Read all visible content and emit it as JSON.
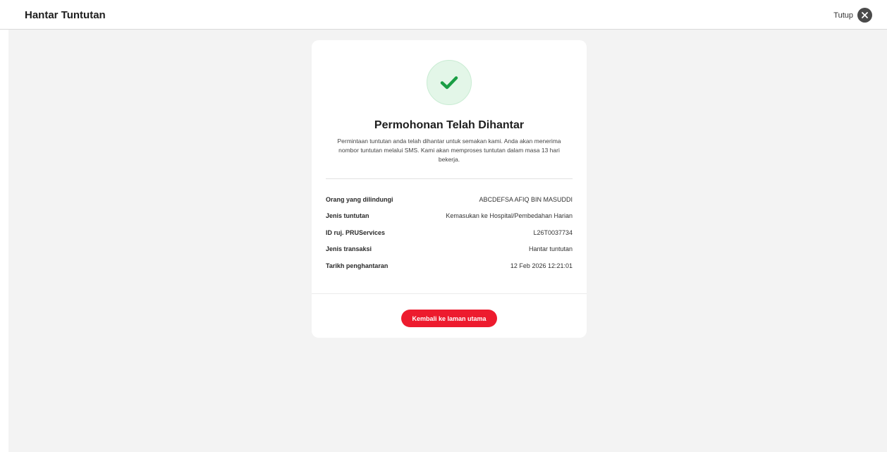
{
  "header": {
    "title": "Hantar Tuntutan",
    "close_label": "Tutup",
    "close_icon": "close-icon"
  },
  "card": {
    "status_icon": "check-icon",
    "colors": {
      "accent": "#ed1b2e",
      "success": "#1a9e45",
      "success_bg": "#e3f6e8"
    },
    "title": "Permohonan Telah Dihantar",
    "description": "Permintaan tuntutan anda telah dihantar untuk semakan kami. Anda akan menerima nombor tuntutan melalui SMS. Kami akan memproses tuntutan dalam masa 13 hari bekerja.",
    "details": [
      {
        "label": "Orang yang dilindungi",
        "value": "ABCDEFSA AFIQ BIN MASUDDI"
      },
      {
        "label": "Jenis tuntutan",
        "value": "Kemasukan ke Hospital/Pembedahan Harian"
      },
      {
        "label": "ID ruj. PRUServices",
        "value": "L26T0037734"
      },
      {
        "label": "Jenis transaksi",
        "value": "Hantar tuntutan"
      },
      {
        "label": "Tarikh penghantaran",
        "value": "12 Feb 2026 12:21:01"
      }
    ],
    "button_label": "Kembali ke laman utama"
  }
}
